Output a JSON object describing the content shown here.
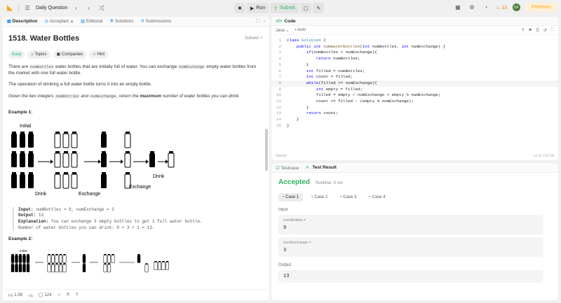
{
  "topbar": {
    "title": "Daily Question",
    "run": "Run",
    "submit": "Submit",
    "streak": "13",
    "premium": "Premium",
    "avatar": "GF"
  },
  "left_tabs": [
    {
      "label": "Description"
    },
    {
      "label": "Accepted"
    },
    {
      "label": "Editorial"
    },
    {
      "label": "Solutions"
    },
    {
      "label": "Submissions"
    }
  ],
  "problem": {
    "title": "1518. Water Bottles",
    "status": "Solved",
    "chips": {
      "difficulty": "Easy",
      "topics": "Topics",
      "companies": "Companies",
      "hint": "Hint"
    },
    "p1_a": "There are ",
    "p1_code1": "numBottles",
    "p1_b": " water bottles that are initially full of water. You can exchange ",
    "p1_code2": "numExchange",
    "p1_c": " empty water bottles from the market with one full water bottle.",
    "p2": "The operation of drinking a full water bottle turns it into an empty bottle.",
    "p3_a": "Given the two integers ",
    "p3_code1": "numBottles",
    "p3_b": " and ",
    "p3_code2": "numExchange",
    "p3_c": ", return the ",
    "p3_bold": "maximum",
    "p3_d": " number of water bottles you can drink.",
    "ex1": {
      "heading": "Example 1:",
      "img_initial": "Initial",
      "img_drink1": "Drink",
      "img_exchange1": "Exchange",
      "img_exchange2": "Exchange",
      "img_drink2": "Drink",
      "input_label": "Input:",
      "input": "numBottles = 9, numExchange = 3",
      "output_label": "Output:",
      "output": "13",
      "expl_label": "Explanation:",
      "expl": "You can exchange 3 empty bottles to get 1 full water bottle.",
      "expl2": "Number of water bottles you can drink: 9 + 3 + 1 = 13."
    },
    "ex2": {
      "heading": "Example 2:",
      "img_initial": "Initial"
    }
  },
  "left_bottom": {
    "likes": "1.5K",
    "comments": "124"
  },
  "code": {
    "header": "Code",
    "language": "Java",
    "mode": "Auto",
    "saved": "Saved",
    "cursor": "Ln 8, Col 24",
    "lines": [
      "class Solution {",
      "    public int numWaterBottles(int numBottles, int numExchange) {",
      "        if(numBottles < numExchange){",
      "            return numBottles;",
      "        }",
      "        int filled = numBottles;",
      "        int count = filled;",
      "        while(filled >= numExchange){",
      "            int empty = filled;",
      "            filled = empty / numExchange + empty % numExchange;",
      "            count += filled - (empty % numExchange);",
      "        }",
      "        return count;",
      "    }",
      "}"
    ]
  },
  "result": {
    "tab_testcase": "Testcase",
    "tab_result": "Test Result",
    "status": "Accepted",
    "runtime": "Runtime: 0 ms",
    "cases": [
      "Case 1",
      "Case 2",
      "Case 3",
      "Case 4"
    ],
    "input_label": "Input",
    "var1": "numBottles =",
    "val1": "9",
    "var2": "numExchange =",
    "val2": "3",
    "output_label": "Output",
    "output": "13"
  }
}
